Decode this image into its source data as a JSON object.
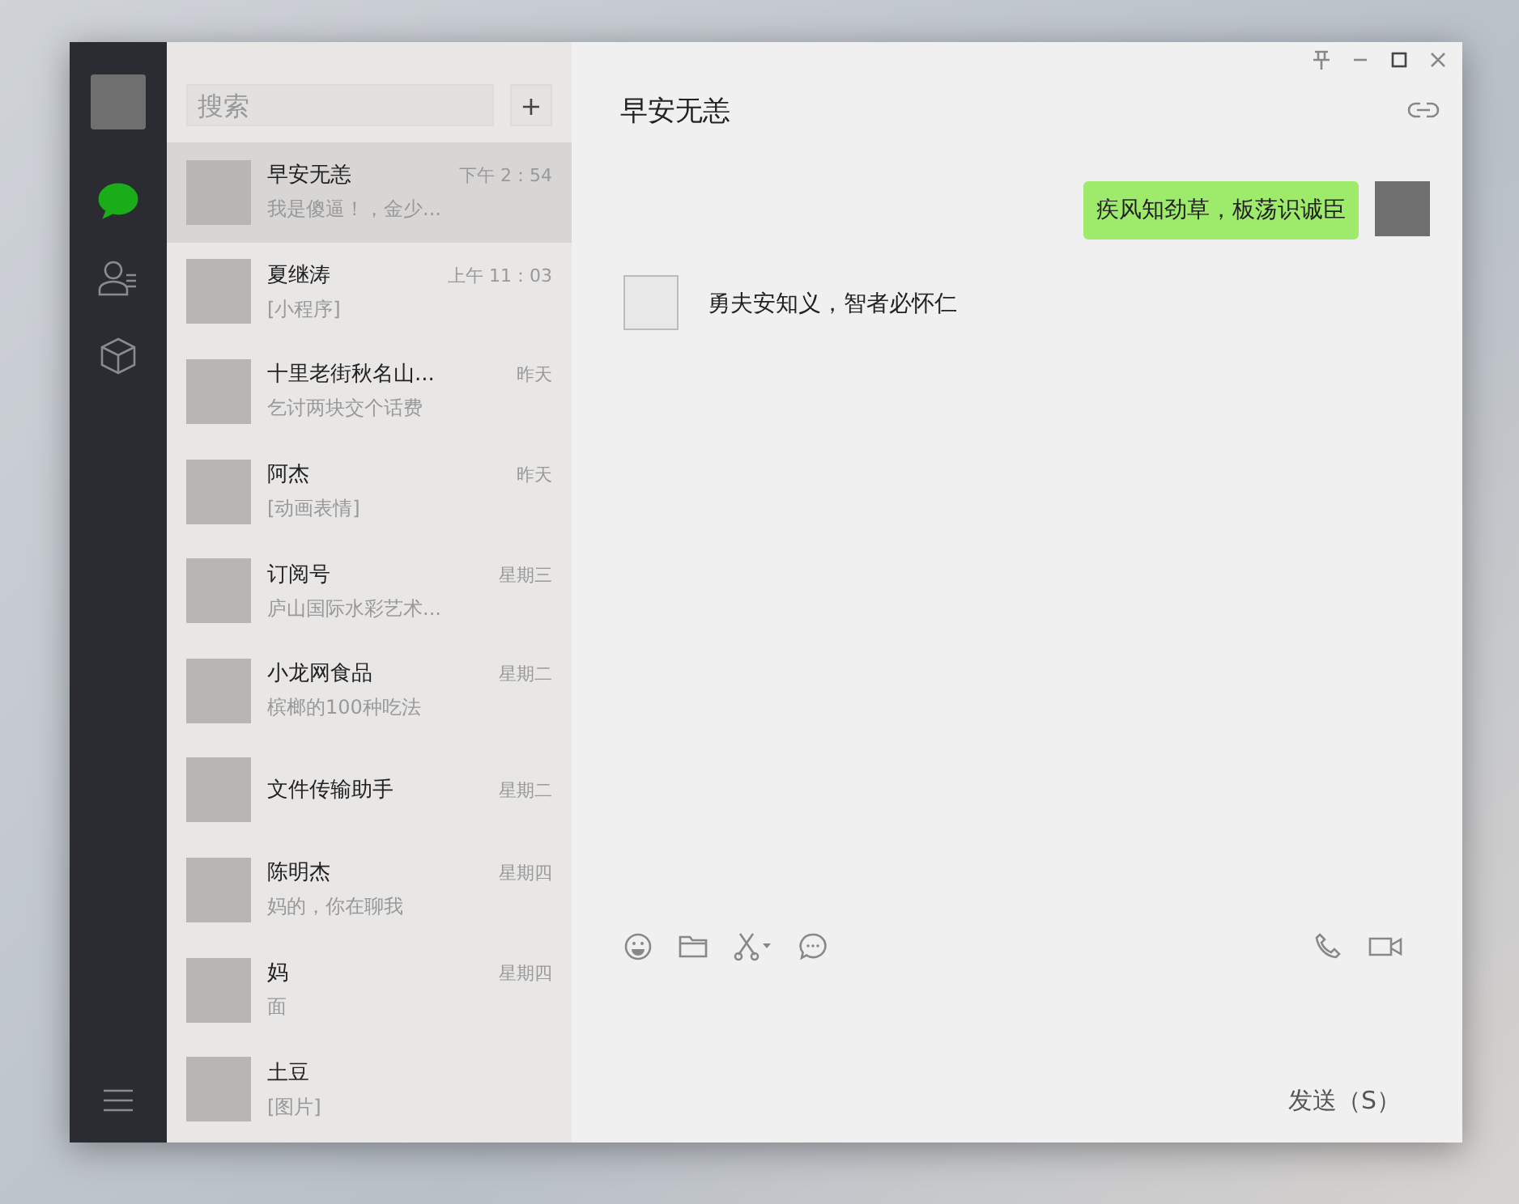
{
  "sidebar": {
    "nav": [
      {
        "kind": "chat",
        "selected": true
      },
      {
        "kind": "contacts",
        "selected": false
      },
      {
        "kind": "box",
        "selected": false
      }
    ]
  },
  "search": {
    "placeholder": "搜索"
  },
  "add_button": "+",
  "chats": [
    {
      "name": "早安无恙",
      "preview": "我是傻逼！，金少...",
      "time": "下午 2：54",
      "selected": true
    },
    {
      "name": "夏继涛",
      "preview": "[小程序]",
      "time": "上午 11：03",
      "selected": false
    },
    {
      "name": "十里老街秋名山...",
      "preview": "乞讨两块交个话费",
      "time": "昨天",
      "selected": false
    },
    {
      "name": "阿杰",
      "preview": "[动画表情]",
      "time": "昨天",
      "selected": false
    },
    {
      "name": "订阅号",
      "preview": "庐山国际水彩艺术...",
      "time": "星期三",
      "selected": false
    },
    {
      "name": "小龙网食品",
      "preview": "槟榔的100种吃法",
      "time": "星期二",
      "selected": false
    },
    {
      "name": "文件传输助手",
      "time": "星期二",
      "selected": false
    },
    {
      "name": "陈明杰",
      "preview": "妈的，你在聊我",
      "time": "星期四",
      "selected": false
    },
    {
      "name": "妈",
      "preview": "面",
      "time": "星期四",
      "selected": false
    },
    {
      "name": "土豆",
      "preview": "[图片]",
      "selected": false
    }
  ],
  "conversation": {
    "title": "早安无恙",
    "messages": [
      {
        "kind": "sent",
        "text": "疾风知劲草，板荡识诚臣"
      },
      {
        "kind": "received",
        "text": "勇夫安知义，智者必怀仁"
      }
    ]
  },
  "send_button": "发送（S）"
}
